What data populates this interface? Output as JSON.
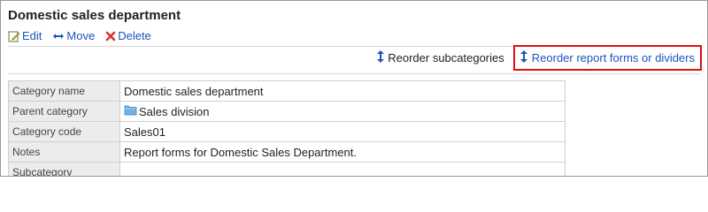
{
  "page": {
    "title": "Domestic sales department"
  },
  "toolbar": {
    "edit_label": "Edit",
    "move_label": "Move",
    "delete_label": "Delete"
  },
  "reorder": {
    "subcategories_label": "Reorder subcategories",
    "forms_label": "Reorder report forms or dividers"
  },
  "details": {
    "rows": [
      {
        "key": "Category name",
        "value": "Domestic sales department"
      },
      {
        "key": "Parent category",
        "value": "Sales division"
      },
      {
        "key": "Category code",
        "value": "Sales01"
      },
      {
        "key": "Notes",
        "value": "Report forms for Domestic Sales Department."
      },
      {
        "key": "Subcategory",
        "value": ""
      }
    ]
  },
  "colors": {
    "link": "#1a55b8",
    "highlight_border": "#e01010",
    "label_bg": "#ececec",
    "delete_icon": "#d9372b"
  },
  "icons": {
    "edit": "pencil-icon",
    "move": "move-arrows-icon",
    "delete": "delete-x-icon",
    "reorder": "vertical-arrows-icon",
    "parent": "folder-icon"
  }
}
